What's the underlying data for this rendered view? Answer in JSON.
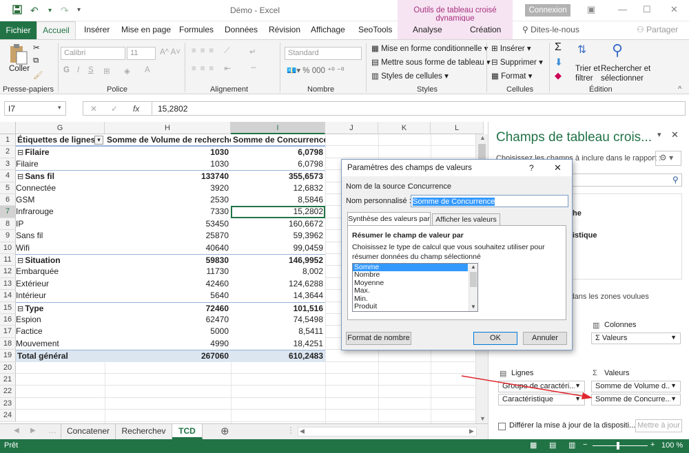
{
  "title_bar": {
    "document_title": "Démo  -  Excel",
    "contextual_tools": "Outils de tableau croisé dynamique",
    "connexion_label": "Connexion"
  },
  "ribbon_tabs": [
    {
      "label": "Fichier"
    },
    {
      "label": "Accueil"
    },
    {
      "label": "Insérer"
    },
    {
      "label": "Mise en page"
    },
    {
      "label": "Formules"
    },
    {
      "label": "Données"
    },
    {
      "label": "Révision"
    },
    {
      "label": "Affichage"
    },
    {
      "label": "SeoTools"
    },
    {
      "label": "Analyse"
    },
    {
      "label": "Création"
    }
  ],
  "tell_me": "Dites-le-nous",
  "share": "Partager",
  "ribbon": {
    "clipboard": {
      "paste_label": "Coller",
      "group_label": "Presse-papiers"
    },
    "font": {
      "font_name": "Calibri",
      "font_size": "11",
      "group_label": "Police"
    },
    "alignment": {
      "group_label": "Alignement"
    },
    "number": {
      "format": "Standard",
      "group_label": "Nombre"
    },
    "styles": {
      "conditional": "Mise en forme conditionnelle",
      "table": "Mettre sous forme de tableau",
      "cell_styles": "Styles de cellules",
      "group_label": "Styles"
    },
    "cells": {
      "insert": "Insérer",
      "delete": "Supprimer",
      "format": "Format",
      "group_label": "Cellules"
    },
    "editing": {
      "sort_line1": "Trier et",
      "sort_line2": "filtrer",
      "find_line1": "Rechercher et",
      "find_line2": "sélectionner",
      "group_label": "Édition"
    }
  },
  "formula_bar": {
    "name_box": "I7",
    "fx": "fx",
    "formula": "15,2802"
  },
  "grid": {
    "columns": [
      "G",
      "H",
      "I",
      "J",
      "K",
      "L"
    ],
    "rows": [
      {
        "n": "1",
        "g": "Étiquettes de lignes",
        "h": "Somme de Volume de recherche",
        "i": "Somme de Concurrence",
        "type": "header"
      },
      {
        "n": "2",
        "g": "Filaire",
        "h": "1030",
        "i": "6,0798",
        "type": "group"
      },
      {
        "n": "3",
        "g": "Filaire",
        "h": "1030",
        "i": "6,0798",
        "type": "item"
      },
      {
        "n": "4",
        "g": "Sans fil",
        "h": "133740",
        "i": "355,6573",
        "type": "group"
      },
      {
        "n": "5",
        "g": "Connectée",
        "h": "3920",
        "i": "12,6832",
        "type": "item"
      },
      {
        "n": "6",
        "g": "GSM",
        "h": "2530",
        "i": "8,5846",
        "type": "item"
      },
      {
        "n": "7",
        "g": "Infrarouge",
        "h": "7330",
        "i": "15,2802",
        "type": "item"
      },
      {
        "n": "8",
        "g": "IP",
        "h": "53450",
        "i": "160,6672",
        "type": "item"
      },
      {
        "n": "9",
        "g": "Sans fil",
        "h": "25870",
        "i": "59,3962",
        "type": "item"
      },
      {
        "n": "10",
        "g": "Wifi",
        "h": "40640",
        "i": "99,0459",
        "type": "item"
      },
      {
        "n": "11",
        "g": "Situation",
        "h": "59830",
        "i": "146,9952",
        "type": "group"
      },
      {
        "n": "12",
        "g": "Embarquée",
        "h": "11730",
        "i": "8,002",
        "type": "item"
      },
      {
        "n": "13",
        "g": "Extérieur",
        "h": "42460",
        "i": "124,6288",
        "type": "item"
      },
      {
        "n": "14",
        "g": "Intérieur",
        "h": "5640",
        "i": "14,3644",
        "type": "item"
      },
      {
        "n": "15",
        "g": "Type",
        "h": "72460",
        "i": "101,516",
        "type": "group"
      },
      {
        "n": "16",
        "g": "Espion",
        "h": "62470",
        "i": "74,5498",
        "type": "item"
      },
      {
        "n": "17",
        "g": "Factice",
        "h": "5000",
        "i": "8,5411",
        "type": "item"
      },
      {
        "n": "18",
        "g": "Mouvement",
        "h": "4990",
        "i": "18,4251",
        "type": "item"
      },
      {
        "n": "19",
        "g": "Total général",
        "h": "267060",
        "i": "610,2483",
        "type": "total"
      },
      {
        "n": "20",
        "g": "",
        "h": "",
        "i": "",
        "type": "empty"
      },
      {
        "n": "21",
        "g": "",
        "h": "",
        "i": "",
        "type": "empty"
      },
      {
        "n": "22",
        "g": "",
        "h": "",
        "i": "",
        "type": "empty"
      },
      {
        "n": "23",
        "g": "",
        "h": "",
        "i": "",
        "type": "empty"
      },
      {
        "n": "24",
        "g": "",
        "h": "",
        "i": "",
        "type": "empty"
      }
    ]
  },
  "sheet_tabs": [
    {
      "label": "Concatener"
    },
    {
      "label": "Recherchev"
    },
    {
      "label": "TCD"
    }
  ],
  "status": {
    "ready": "Prêt",
    "zoom": "100 %"
  },
  "pane": {
    "title": "Champs de tableau crois...",
    "subtitle": "Choisissez les champs à inclure dans le rapport :",
    "partial_field_1": "he",
    "partial_field_2": "istique",
    "drag_hint": "s dans les zones voulues",
    "columns_label": "Colonnes",
    "columns_item": "Σ Valeurs",
    "rows_label": "Lignes",
    "rows_items": [
      "Groupe de caractéri...",
      "Caractéristique"
    ],
    "values_label": "Valeurs",
    "values_items": [
      "Somme de Volume d...",
      "Somme de Concurre..."
    ],
    "defer_label": "Différer la mise à jour de la dispositi...",
    "update_button": "Mettre à jour"
  },
  "dialog": {
    "title": "Paramètres des champs de valeurs",
    "help": "?",
    "source_label": "Nom de la source :",
    "source_value": "Concurrence",
    "custom_label": "Nom personnalisé :",
    "custom_value": "Somme de Concurrence",
    "tabs": [
      {
        "label": "Synthèse des valeurs par"
      },
      {
        "label": "Afficher les valeurs"
      }
    ],
    "section_title": "Résumer le champ de valeur par",
    "instruction": "Choisissez le type de calcul que vous souhaitez utiliser pour résumer données du champ sélectionné",
    "functions": [
      "Somme",
      "Nombre",
      "Moyenne",
      "Max.",
      "Min.",
      "Produit"
    ],
    "selected_function": "Somme",
    "number_format_button": "Format de nombre",
    "ok_button": "OK",
    "cancel_button": "Annuler"
  },
  "colors": {
    "excel_green": "#217346",
    "pivot_header_blue": "#dce6f1",
    "annotation_red": "#e0282e",
    "selection_blue": "#3399ff"
  }
}
